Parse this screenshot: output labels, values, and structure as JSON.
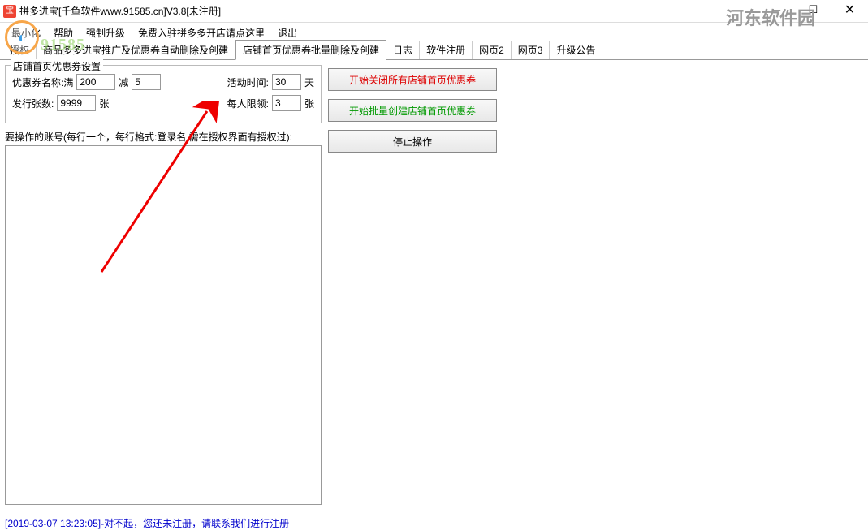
{
  "window": {
    "title": "拼多进宝[千鱼软件www.91585.cn]V3.8[未注册]",
    "icon_label": "宝"
  },
  "menu": {
    "items": [
      "最小化",
      "帮助",
      "强制升级",
      "免费入驻拼多多开店请点这里",
      "退出"
    ]
  },
  "overlay_brand": "91585",
  "watermark": "河东软件园",
  "tabs": {
    "items": [
      "授权",
      "商品多多进宝推广及优惠券自动删除及创建",
      "店铺首页优惠券批量删除及创建",
      "日志",
      "软件注册",
      "网页2",
      "网页3",
      "升级公告"
    ],
    "active_index": 2
  },
  "groupbox": {
    "legend": "店铺首页优惠券设置",
    "coupon_name_label": "优惠券名称:满",
    "coupon_full_value": "200",
    "minus_label": "减",
    "coupon_minus_value": "5",
    "activity_time_label": "活动时间:",
    "activity_time_value": "30",
    "day_label": "天",
    "issue_count_label": "发行张数:",
    "issue_count_value": "9999",
    "sheet_label": "张",
    "limit_label": "每人限领:",
    "limit_value": "3",
    "sheet_label2": "张"
  },
  "accounts_label": "要操作的账号(每行一个，每行格式:登录名.需在授权界面有授权过):",
  "buttons": {
    "close_all": "开始关闭所有店铺首页优惠券",
    "batch_create": "开始批量创建店铺首页优惠券",
    "stop": "停止操作"
  },
  "status": "[2019-03-07 13:23:05]-对不起，您还未注册，请联系我们进行注册"
}
